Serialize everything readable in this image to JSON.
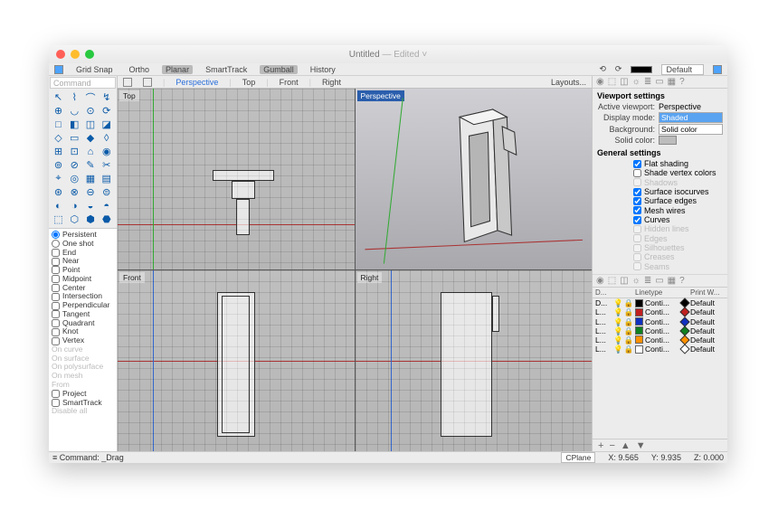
{
  "window": {
    "title": "Untitled",
    "edited": "— Edited ˅"
  },
  "toolbar": {
    "items": [
      "Grid Snap",
      "Ortho",
      "Planar",
      "SmartTrack",
      "Gumball",
      "History"
    ],
    "active_items": [
      "Planar",
      "Gumball"
    ],
    "layer_select": "Default"
  },
  "command": {
    "placeholder": "Command"
  },
  "vp_tabs": {
    "items": [
      "Perspective",
      "Top",
      "Front",
      "Right"
    ],
    "active": "Perspective",
    "right": "Layouts..."
  },
  "viewports": {
    "top_left": "Top",
    "top_right": "Perspective",
    "bottom_left": "Front",
    "bottom_right": "Right",
    "active": "Perspective"
  },
  "osnap": {
    "persistent": "Persistent",
    "one_shot": "One shot",
    "selected": "Persistent",
    "checks": [
      "End",
      "Near",
      "Point",
      "Midpoint",
      "Center",
      "Intersection",
      "Perpendicular",
      "Tangent",
      "Quadrant",
      "Knot",
      "Vertex"
    ],
    "disabled": [
      "On curve",
      "On surface",
      "On polysurface",
      "On mesh",
      "From"
    ],
    "checks2": [
      "Project",
      "SmartTrack"
    ],
    "disabled2": "Disable all"
  },
  "settings": {
    "title": "Viewport settings",
    "active_viewport_lbl": "Active viewport:",
    "active_viewport": "Perspective",
    "display_mode_lbl": "Display mode:",
    "display_mode": "Shaded",
    "background_lbl": "Background:",
    "background": "Solid color",
    "solid_color_lbl": "Solid color:",
    "general_title": "General settings",
    "checks": [
      {
        "label": "Flat shading",
        "on": true,
        "dis": false
      },
      {
        "label": "Shade vertex colors",
        "on": false,
        "dis": false
      },
      {
        "label": "Shadows",
        "on": false,
        "dis": true
      },
      {
        "label": "Surface isocurves",
        "on": true,
        "dis": false
      },
      {
        "label": "Surface edges",
        "on": true,
        "dis": false
      },
      {
        "label": "Mesh wires",
        "on": true,
        "dis": false
      },
      {
        "label": "Curves",
        "on": true,
        "dis": false
      },
      {
        "label": "Hidden lines",
        "on": false,
        "dis": true
      },
      {
        "label": "Edges",
        "on": false,
        "dis": true
      },
      {
        "label": "Silhouettes",
        "on": false,
        "dis": true
      },
      {
        "label": "Creases",
        "on": false,
        "dis": true
      },
      {
        "label": "Seams",
        "on": false,
        "dis": true
      }
    ]
  },
  "layers": {
    "head": [
      "D...",
      "",
      "Linetype",
      "Print W..."
    ],
    "rows": [
      {
        "name": "D...",
        "sw": "#000000",
        "dmd": "#000000",
        "linetype": "Conti...",
        "pw": "Default"
      },
      {
        "name": "L...",
        "sw": "#c02020",
        "dmd": "#c02020",
        "linetype": "Conti...",
        "pw": "Default"
      },
      {
        "name": "L...",
        "sw": "#1030c0",
        "dmd": "#1030c0",
        "linetype": "Conti...",
        "pw": "Default"
      },
      {
        "name": "L...",
        "sw": "#108020",
        "dmd": "#108020",
        "linetype": "Conti...",
        "pw": "Default"
      },
      {
        "name": "L...",
        "sw": "#ff9000",
        "dmd": "#ff9000",
        "linetype": "Conti...",
        "pw": "Default"
      },
      {
        "name": "L...",
        "sw": "#ffffff",
        "dmd": "#ffffff",
        "linetype": "Conti...",
        "pw": "Default"
      }
    ]
  },
  "status": {
    "cmd_label": "Command:",
    "cmd_value": "_Drag",
    "cplane": "CPlane",
    "x_lbl": "X:",
    "x": "9.565",
    "y_lbl": "Y:",
    "y": "9.935",
    "z_lbl": "Z:",
    "z": "0.000"
  },
  "tool_icons": [
    "↖",
    "⌇",
    "⌒",
    "↯",
    "⊕",
    "◡",
    "⊙",
    "⟳",
    "□",
    "◧",
    "◫",
    "◪",
    "◇",
    "▭",
    "◆",
    "◊",
    "⊞",
    "⊡",
    "⌂",
    "◉",
    "⊚",
    "⊘",
    "✎",
    "✂",
    "⌖",
    "◎",
    "▦",
    "▤",
    "⊛",
    "⊗",
    "⊖",
    "⊜",
    "◐",
    "◑",
    "◒",
    "◓",
    "⬚",
    "⬡",
    "⬢",
    "⬣"
  ]
}
